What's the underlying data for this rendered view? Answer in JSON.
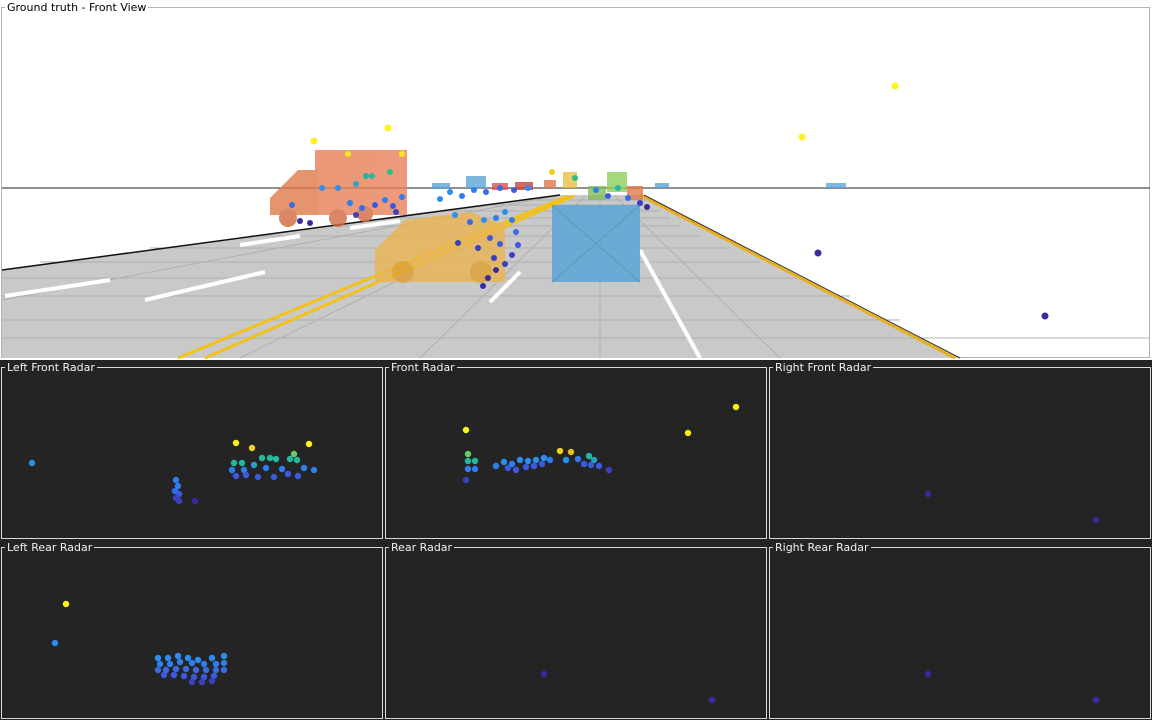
{
  "panels": {
    "front": {
      "title": "Ground truth - Front View"
    },
    "left_front": {
      "title": "Left Front Radar"
    },
    "front_radar": {
      "title": "Front Radar"
    },
    "right_front": {
      "title": "Right Front Radar"
    },
    "left_rear": {
      "title": "Left Rear Radar"
    },
    "rear": {
      "title": "Rear Radar"
    },
    "right_rear": {
      "title": "Right Rear Radar"
    }
  },
  "colors": {
    "background_dark": "#242424",
    "road": "#c8c8c8",
    "lane_yellow": "#f5c518",
    "vehicle_orange": "#e07a4a",
    "vehicle_yellow": "#e8b040",
    "vehicle_blue": "#5aa5d6",
    "detection_near": "#3a2aa0",
    "detection_mid": "#2e7ef0",
    "detection_teal": "#24b8a0",
    "detection_far": "#fff21a"
  }
}
